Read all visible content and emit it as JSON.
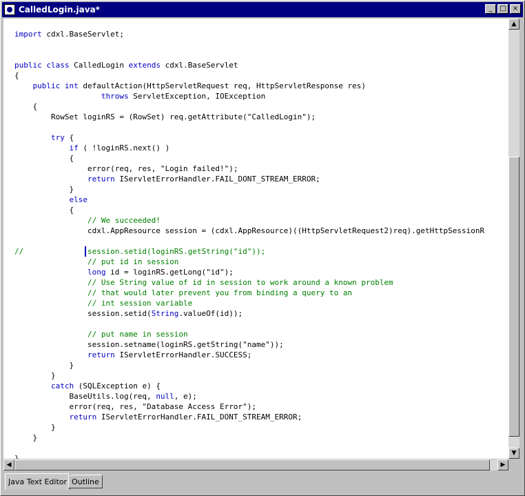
{
  "window": {
    "title": "CalledLogin.java*",
    "minimize_glyph": "_",
    "maximize_glyph": "□",
    "close_glyph": "×"
  },
  "editor": {
    "lines": [
      [
        [
          "",
          "import"
        ],
        [
          "",
          " cdxl.BaseServlet;"
        ]
      ],
      [],
      [],
      [
        [
          "kw",
          "public"
        ],
        [
          "",
          " "
        ],
        [
          "kw",
          "class"
        ],
        [
          "",
          " CalledLogin "
        ],
        [
          "kw",
          "extends"
        ],
        [
          "",
          " cdxl.BaseServlet"
        ]
      ],
      [
        [
          "",
          "{"
        ]
      ],
      [
        [
          "",
          "    "
        ],
        [
          "kw",
          "public"
        ],
        [
          "",
          " "
        ],
        [
          "kw",
          "int"
        ],
        [
          "",
          " defaultAction(HttpServletRequest req, HttpServletResponse res)"
        ]
      ],
      [
        [
          "",
          "                   "
        ],
        [
          "kw",
          "throws"
        ],
        [
          "",
          " ServletException, IOException"
        ]
      ],
      [
        [
          "",
          "    {"
        ]
      ],
      [
        [
          "",
          "        RowSet loginRS = (RowSet) req.getAttribute(\"CalledLogin\");"
        ]
      ],
      [],
      [
        [
          "",
          "        "
        ],
        [
          "kw",
          "try"
        ],
        [
          "",
          " {"
        ]
      ],
      [
        [
          "",
          "            "
        ],
        [
          "kw",
          "if"
        ],
        [
          "",
          " ( !loginRS.next() )"
        ]
      ],
      [
        [
          "",
          "            {"
        ]
      ],
      [
        [
          "",
          "                error(req, res, \"Login failed!\");"
        ]
      ],
      [
        [
          "",
          "                "
        ],
        [
          "kw",
          "return"
        ],
        [
          "",
          " IServletErrorHandler.FAIL_DONT_STREAM_ERROR;"
        ]
      ],
      [
        [
          "",
          "            }"
        ]
      ],
      [
        [
          "",
          "            "
        ],
        [
          "kw",
          "else"
        ]
      ],
      [
        [
          "",
          "            {"
        ]
      ],
      [
        [
          "",
          "                "
        ],
        [
          "cm",
          "// We succeeded!"
        ]
      ],
      [
        [
          "",
          "                cdxl.AppResource session = (cdxl.AppResource)((HttpServletRequest2)req).getHttpSessionR"
        ]
      ],
      [],
      [
        [
          "cm",
          "//              session.setid(loginRS.getString(\"id\"));"
        ]
      ],
      [
        [
          "",
          "                "
        ],
        [
          "cm",
          "// put id in session"
        ]
      ],
      [
        [
          "",
          "                "
        ],
        [
          "kw",
          "long"
        ],
        [
          "",
          " id = loginRS.getLong(\"id\");"
        ]
      ],
      [
        [
          "",
          "                "
        ],
        [
          "cm",
          "// Use String value of id in session to work around a known problem"
        ]
      ],
      [
        [
          "",
          "                "
        ],
        [
          "cm",
          "// that would later prevent you from binding a query to an"
        ]
      ],
      [
        [
          "",
          "                "
        ],
        [
          "cm",
          "// int session variable"
        ]
      ],
      [
        [
          "",
          "                session.setid("
        ],
        [
          "kw",
          "String"
        ],
        [
          "",
          ".valueOf(id));"
        ]
      ],
      [],
      [
        [
          "",
          "                "
        ],
        [
          "cm",
          "// put name in session"
        ]
      ],
      [
        [
          "",
          "                session.setname(loginRS.getString(\"name\"));"
        ]
      ],
      [
        [
          "",
          "                "
        ],
        [
          "kw",
          "return"
        ],
        [
          "",
          " IServletErrorHandler.SUCCESS;"
        ]
      ],
      [
        [
          "",
          "            }"
        ]
      ],
      [
        [
          "",
          "        }"
        ]
      ],
      [
        [
          "",
          "        "
        ],
        [
          "kw",
          "catch"
        ],
        [
          "",
          " (SQLException e) {"
        ]
      ],
      [
        [
          "",
          "            BaseUtils.log(req, "
        ],
        [
          "kw",
          "null"
        ],
        [
          "",
          ", e);"
        ]
      ],
      [
        [
          "",
          "            error(req, res, \"Database Access Error\");"
        ]
      ],
      [
        [
          "",
          "            "
        ],
        [
          "kw",
          "return"
        ],
        [
          "",
          " IServletErrorHandler.FAIL_DONT_STREAM_ERROR;"
        ]
      ],
      [
        [
          "",
          "        }"
        ]
      ],
      [
        [
          "",
          "    }"
        ]
      ],
      [],
      [
        [
          "",
          "}"
        ]
      ]
    ]
  },
  "tabs": [
    {
      "label": "Java Text Editor",
      "active": true
    },
    {
      "label": "Outline",
      "active": false
    }
  ],
  "colors": {
    "keyword": "#0000c0",
    "comment": "#008000",
    "titlebar": "#000080"
  }
}
